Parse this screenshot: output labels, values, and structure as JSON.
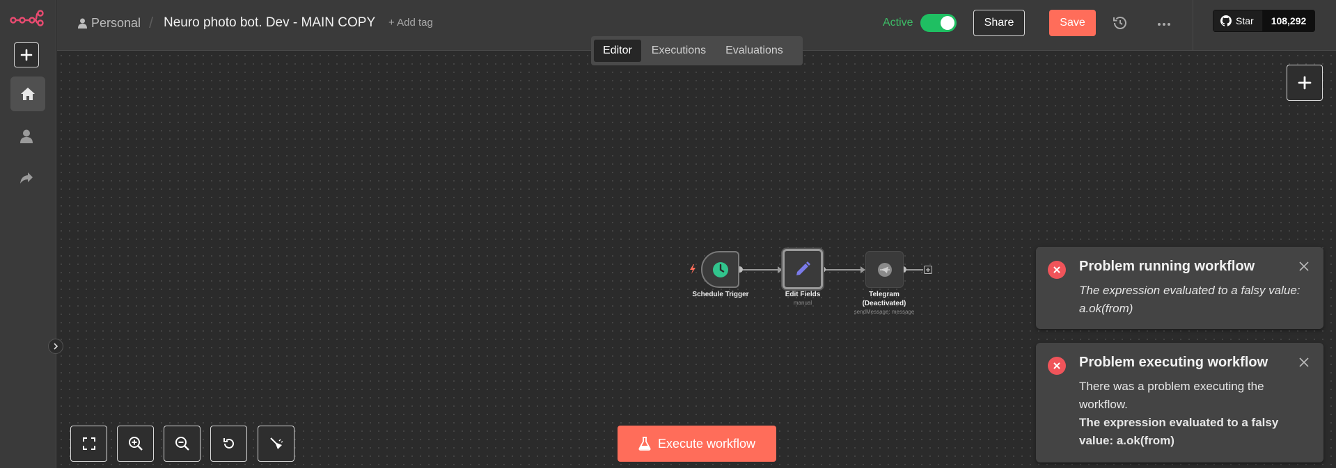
{
  "header": {
    "project": "Personal",
    "separator": "/",
    "workflow_name": "Neuro photo bot. Dev - MAIN COPY",
    "add_tag": "+ Add tag",
    "active_label": "Active",
    "active": true,
    "share_label": "Share",
    "save_label": "Save",
    "github_star_label": "Star",
    "github_star_count": "108,292"
  },
  "tabs": [
    {
      "label": "Editor",
      "active": true
    },
    {
      "label": "Executions",
      "active": false
    },
    {
      "label": "Evaluations",
      "active": false
    }
  ],
  "nodes": [
    {
      "name": "Schedule Trigger",
      "subtitle": ""
    },
    {
      "name": "Edit Fields",
      "subtitle": "manual"
    },
    {
      "name": "Telegram",
      "name_line2": "(Deactivated)",
      "subtitle": "sendMessage: message"
    }
  ],
  "execute_label": "Execute workflow",
  "toasts": [
    {
      "title": "Problem running workflow",
      "body": "The expression evaluated to a falsy value: a.ok(from)"
    },
    {
      "title": "Problem executing workflow",
      "body": "There was a problem executing the workflow.",
      "detail": "The expression evaluated to a falsy value: a.ok(from)"
    }
  ],
  "colors": {
    "accent": "#ff6d5a",
    "active_green": "#1fbf62",
    "error_red": "#f0545a",
    "background": "#2b2b2b",
    "panel": "#3a3a3a"
  },
  "icons": {
    "logo": "n8n-logo",
    "sidebar": [
      "plus-icon",
      "home-icon",
      "user-icon",
      "share-icon",
      "chevron-right-icon"
    ],
    "canvas_controls": [
      "fit-view-icon",
      "zoom-in-icon",
      "zoom-out-icon",
      "reset-zoom-icon",
      "tidy-up-icon"
    ],
    "execute": "flask-icon"
  }
}
